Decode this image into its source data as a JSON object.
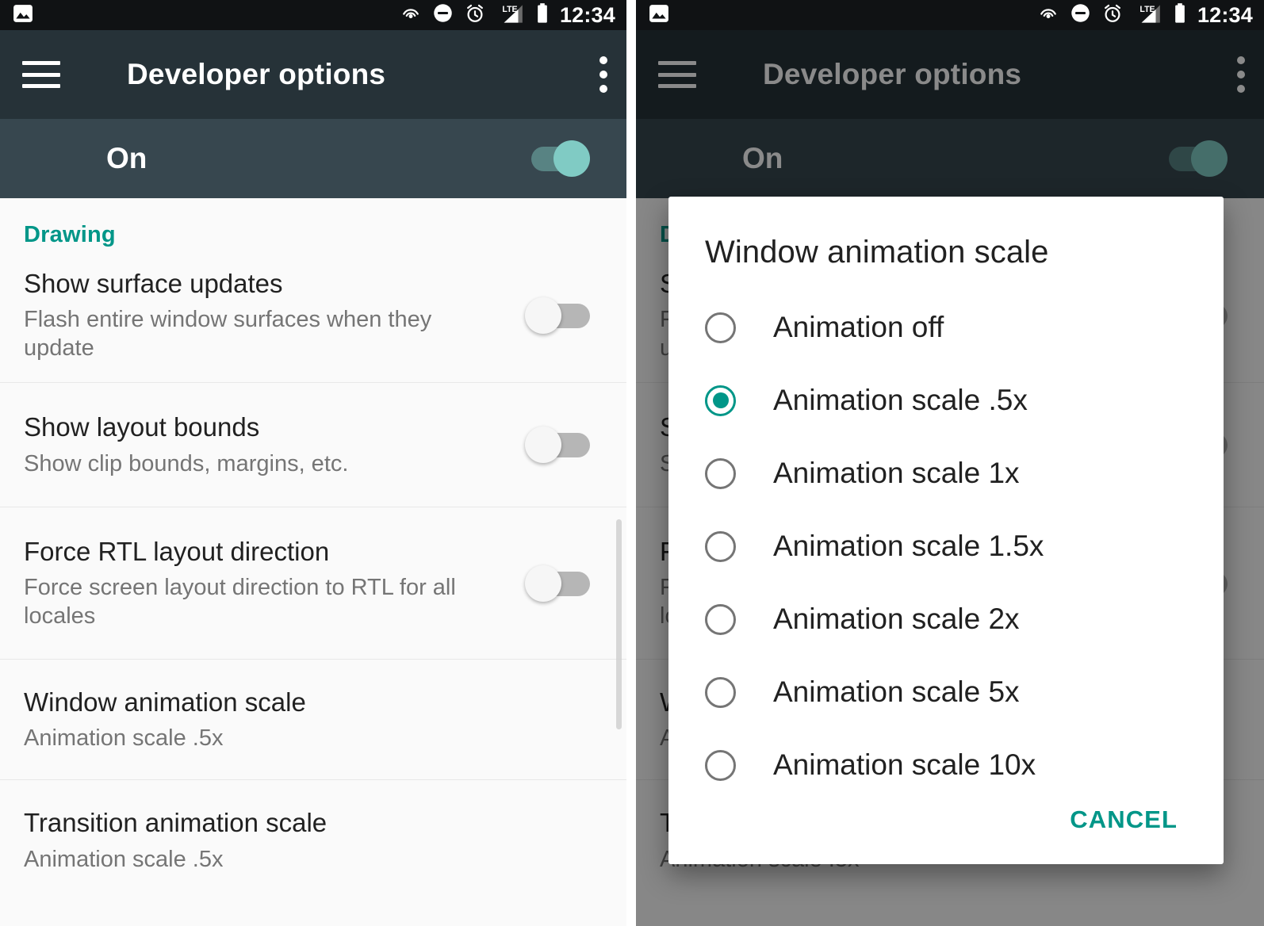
{
  "colors": {
    "accent_teal": "#009688",
    "toggle_on_thumb": "#80CBC4",
    "toolbar_bg": "#263238",
    "master_row_bg": "#37474F",
    "statusbar_bg": "#101214",
    "content_bg": "#fafafa"
  },
  "status_bar": {
    "app_icon": "image-icon",
    "icons": [
      "cast-icon",
      "do-not-disturb-icon",
      "alarm-icon",
      "lte-signal-icon",
      "battery-icon"
    ],
    "lte_label": "LTE",
    "time": "12:34"
  },
  "toolbar": {
    "menu_icon": "hamburger-menu-icon",
    "title": "Developer options",
    "overflow_icon": "overflow-menu-icon"
  },
  "master_toggle": {
    "label": "On",
    "state": "on"
  },
  "section": {
    "header": "Drawing"
  },
  "settings": [
    {
      "title": "Show surface updates",
      "subtitle": "Flash entire window surfaces when they update",
      "control": "switch",
      "state": "off"
    },
    {
      "title": "Show layout bounds",
      "subtitle": "Show clip bounds, margins, etc.",
      "control": "switch",
      "state": "off"
    },
    {
      "title": "Force RTL layout direction",
      "subtitle": "Force screen layout direction to RTL for all locales",
      "control": "switch",
      "state": "off"
    },
    {
      "title": "Window animation scale",
      "subtitle": "Animation scale .5x",
      "control": "none",
      "state": ""
    },
    {
      "title": "Transition animation scale",
      "subtitle": "Animation scale .5x",
      "control": "none",
      "state": ""
    }
  ],
  "dialog": {
    "title": "Window animation scale",
    "options": [
      {
        "label": "Animation off",
        "selected": false
      },
      {
        "label": "Animation scale .5x",
        "selected": true
      },
      {
        "label": "Animation scale 1x",
        "selected": false
      },
      {
        "label": "Animation scale 1.5x",
        "selected": false
      },
      {
        "label": "Animation scale 2x",
        "selected": false
      },
      {
        "label": "Animation scale 5x",
        "selected": false
      },
      {
        "label": "Animation scale 10x",
        "selected": false
      }
    ],
    "cancel_label": "CANCEL"
  }
}
